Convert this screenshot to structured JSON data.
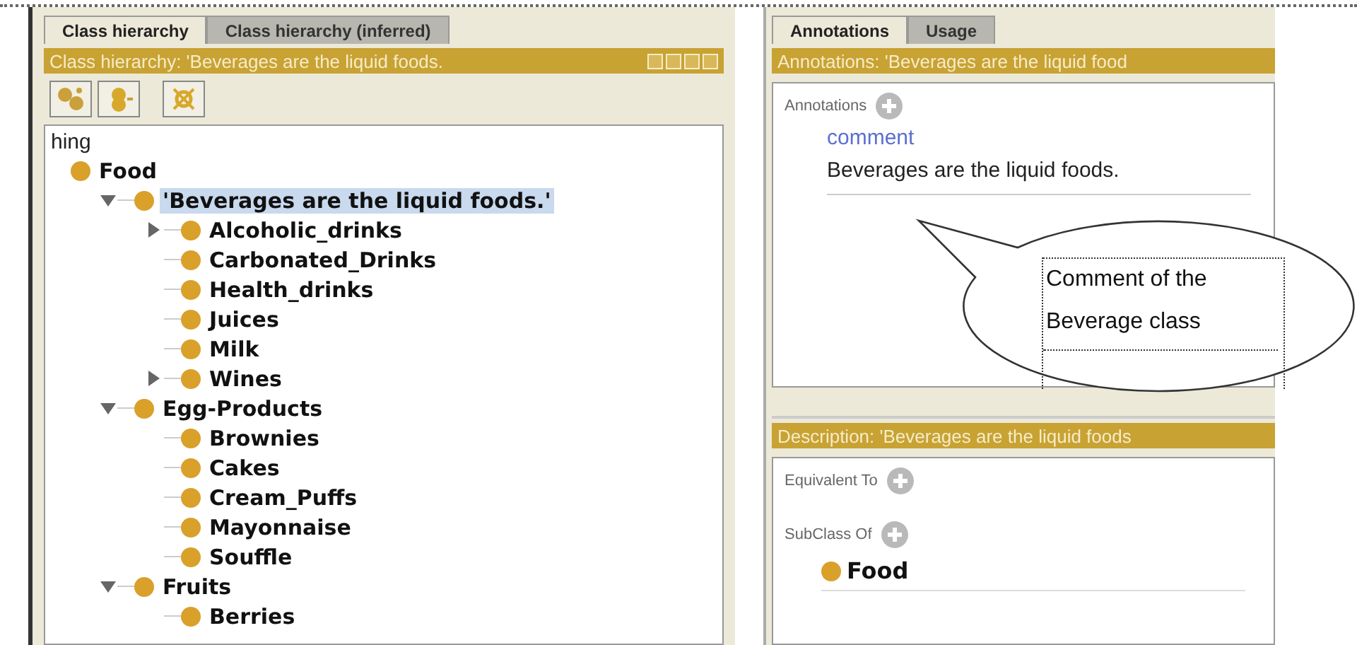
{
  "class_hierarchy_panel": {
    "tabs": [
      {
        "label": "Class hierarchy",
        "selected": true
      },
      {
        "label": "Class hierarchy (inferred)",
        "selected": false
      }
    ],
    "header": "Class hierarchy: 'Beverages are the liquid foods.",
    "root_label": "hing",
    "tree": [
      {
        "label": "Food",
        "selected": false,
        "children": [
          {
            "label": "'Beverages are the liquid foods.'",
            "kind": "expanded",
            "selected": true,
            "children": [
              {
                "label": "Alcoholic_drinks",
                "kind": "collapsed",
                "selected": false
              },
              {
                "label": "Carbonated_Drinks",
                "kind": "leaf",
                "selected": false
              },
              {
                "label": "Health_drinks",
                "kind": "leaf",
                "selected": false
              },
              {
                "label": "Juices",
                "kind": "leaf",
                "selected": false
              },
              {
                "label": "Milk",
                "kind": "leaf",
                "selected": false
              },
              {
                "label": "Wines",
                "kind": "collapsed",
                "selected": false
              }
            ]
          },
          {
            "label": "Egg-Products",
            "kind": "expanded",
            "selected": false,
            "children": [
              {
                "label": "Brownies",
                "kind": "leaf",
                "selected": false
              },
              {
                "label": "Cakes",
                "kind": "leaf",
                "selected": false
              },
              {
                "label": "Cream_Puffs",
                "kind": "leaf",
                "selected": false
              },
              {
                "label": "Mayonnaise",
                "kind": "leaf",
                "selected": false
              },
              {
                "label": "Souffle",
                "kind": "leaf",
                "selected": false
              }
            ]
          },
          {
            "label": "Fruits",
            "kind": "expanded",
            "selected": false,
            "children": [
              {
                "label": "Berries",
                "kind": "leaf",
                "selected": false
              }
            ]
          }
        ]
      }
    ]
  },
  "annotations_panel": {
    "tabs": [
      {
        "label": "Annotations",
        "selected": true
      },
      {
        "label": "Usage",
        "selected": false
      }
    ],
    "header": "Annotations: 'Beverages are the liquid food",
    "section_label": "Annotations",
    "property": "comment",
    "value": "Beverages are the liquid foods."
  },
  "description_panel": {
    "header": "Description: 'Beverages are the liquid foods",
    "sections": [
      {
        "label": "Equivalent To"
      },
      {
        "label": "SubClass Of",
        "items": [
          "Food"
        ]
      }
    ]
  },
  "callout": {
    "text": "Comment of the Beverage class"
  }
}
